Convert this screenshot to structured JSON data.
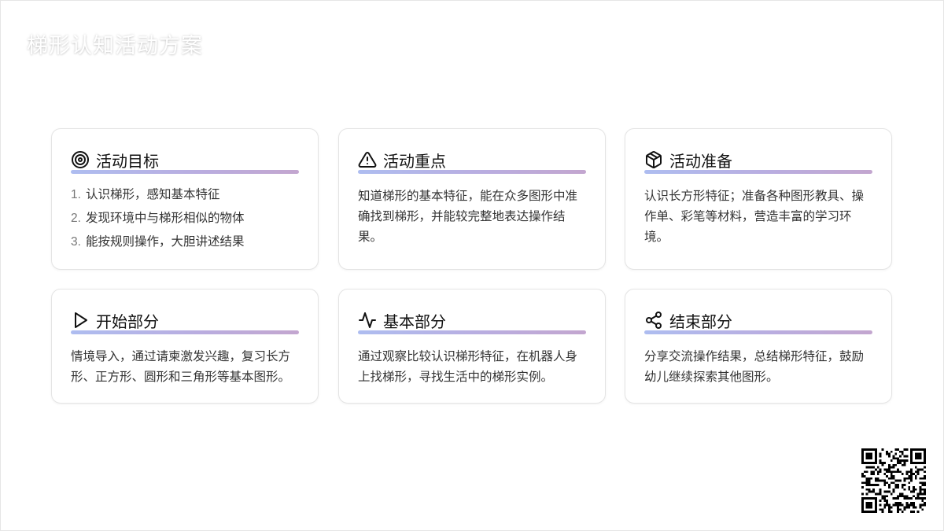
{
  "page": {
    "title": "梯形认知活动方案"
  },
  "cards": [
    {
      "title": "活动目标",
      "icon": "target-icon",
      "list": [
        {
          "num": "1.",
          "text": "认识梯形，感知基本特征"
        },
        {
          "num": "2.",
          "text": "发现环境中与梯形相似的物体"
        },
        {
          "num": "3.",
          "text": "能按规则操作，大胆讲述结果"
        }
      ]
    },
    {
      "title": "活动重点",
      "icon": "warning-icon",
      "text": "知道梯形的基本特征，能在众多图形中准确找到梯形，并能较完整地表达操作结果。"
    },
    {
      "title": "活动准备",
      "icon": "box-icon",
      "text": "认识长方形特征；准备各种图形教具、操作单、彩笔等材料，营造丰富的学习环境。"
    },
    {
      "title": "开始部分",
      "icon": "play-icon",
      "text": "情境导入，通过请柬激发兴趣，复习长方形、正方形、圆形和三角形等基本图形。"
    },
    {
      "title": "基本部分",
      "icon": "activity-icon",
      "text": "通过观察比较认识梯形特征，在机器人身上找梯形，寻找生活中的梯形实例。"
    },
    {
      "title": "结束部分",
      "icon": "share-icon",
      "text": "分享交流操作结果，总结梯形特征，鼓励幼儿继续探索其他图形。"
    }
  ],
  "colors": {
    "accent_start": "#aebdf0",
    "accent_end": "#c3a6cf"
  }
}
